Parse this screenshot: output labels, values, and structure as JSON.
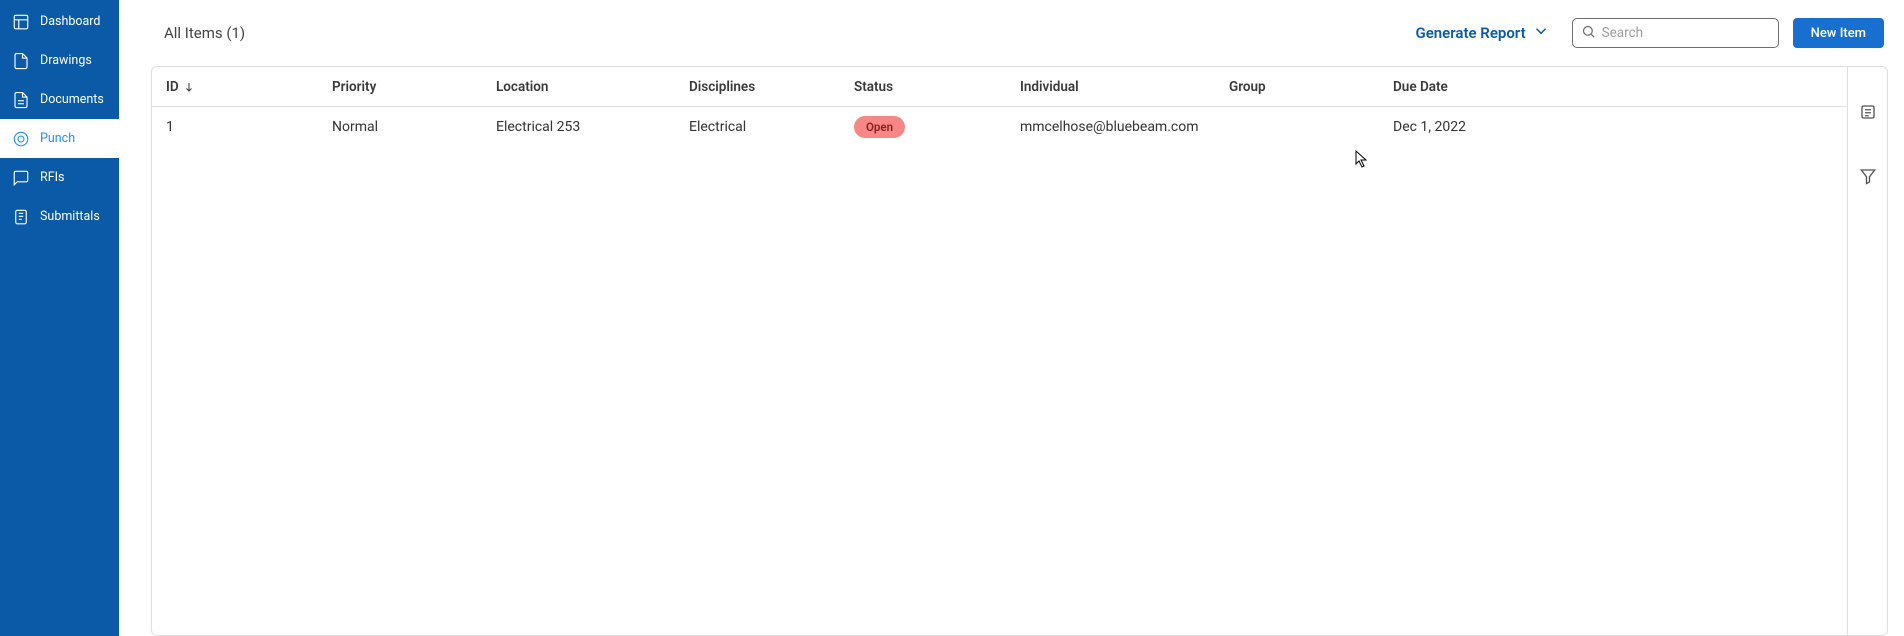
{
  "sidebar": {
    "items": [
      {
        "label": "Dashboard"
      },
      {
        "label": "Drawings"
      },
      {
        "label": "Documents"
      },
      {
        "label": "Punch"
      },
      {
        "label": "RFIs"
      },
      {
        "label": "Submittals"
      }
    ]
  },
  "header": {
    "title": "All Items (1)",
    "generate_report_label": "Generate Report",
    "search_placeholder": "Search",
    "new_item_label": "New Item"
  },
  "table": {
    "columns": {
      "id": "ID",
      "priority": "Priority",
      "location": "Location",
      "disciplines": "Disciplines",
      "status": "Status",
      "individual": "Individual",
      "group": "Group",
      "due_date": "Due Date"
    },
    "rows": [
      {
        "id": "1",
        "priority": "Normal",
        "location": "Electrical 253",
        "disciplines": "Electrical",
        "status": "Open",
        "individual": "mmcelhose@bluebeam.com",
        "group": "",
        "due_date": "Dec 1, 2022"
      }
    ]
  }
}
